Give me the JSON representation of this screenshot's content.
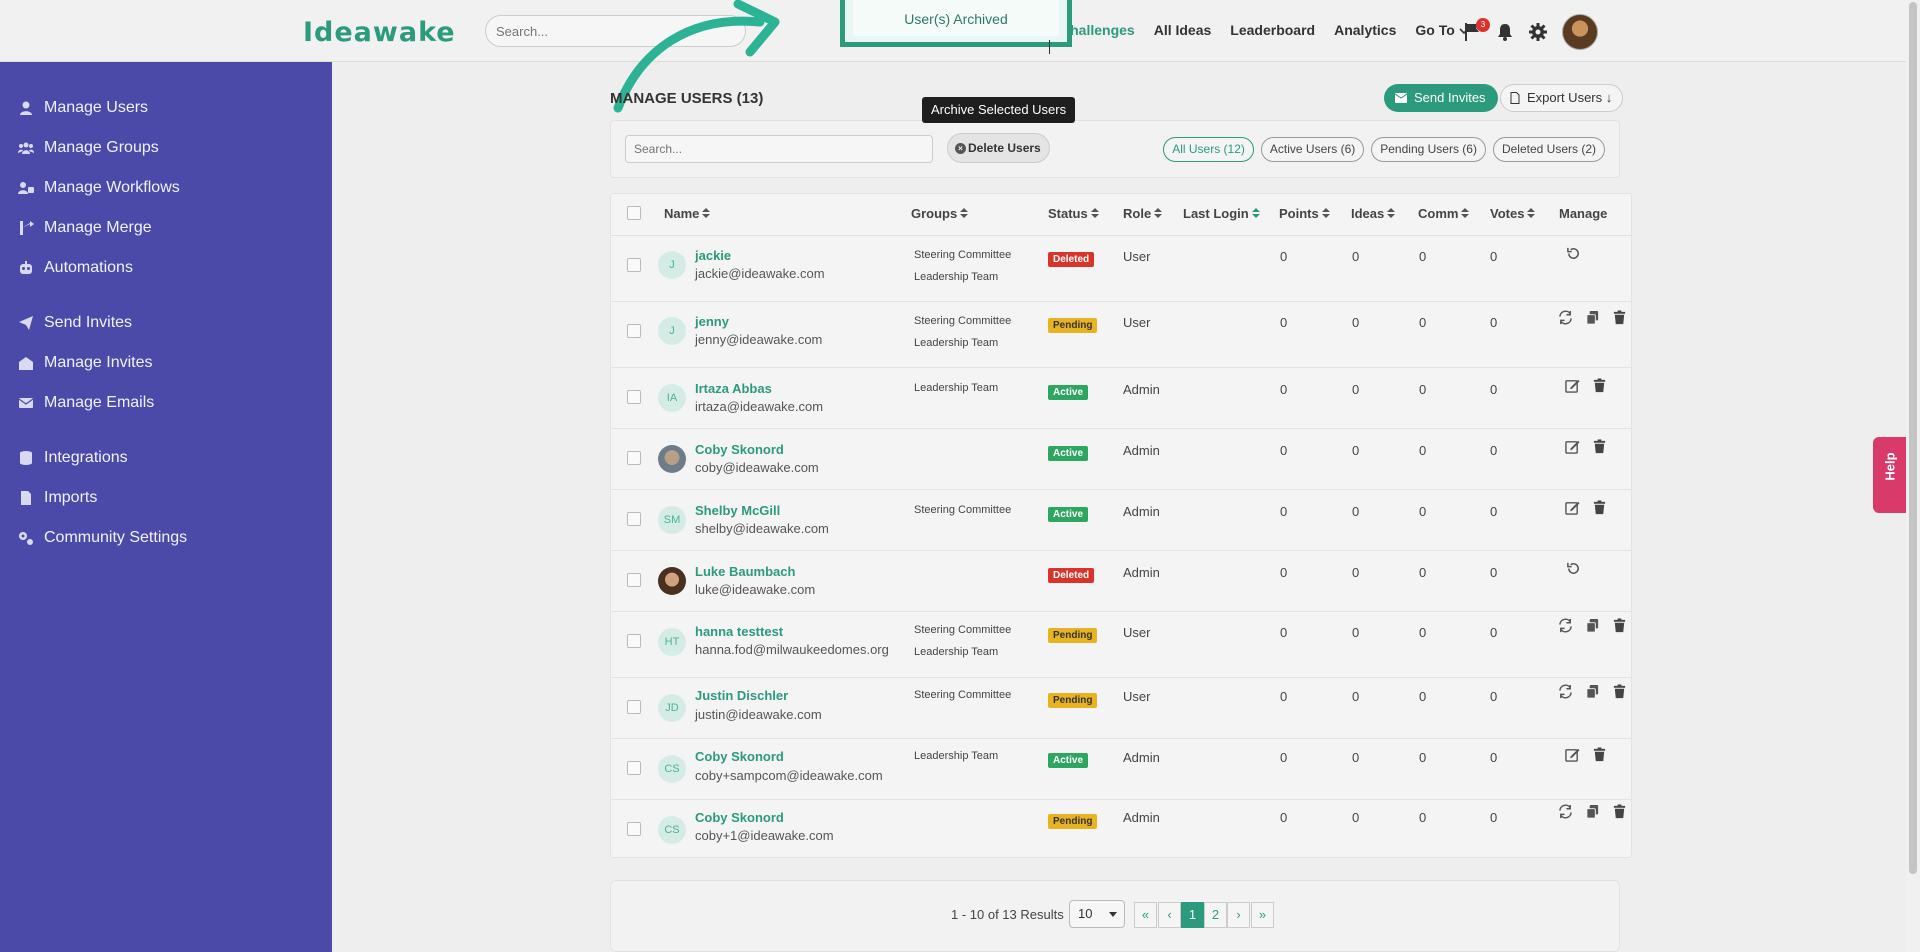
{
  "header": {
    "logo": "Ideawake",
    "search_placeholder": "Search...",
    "nav": [
      "Challenges",
      "All Ideas",
      "Leaderboard",
      "Analytics",
      "Go To"
    ],
    "notification_count": "3"
  },
  "toast": {
    "message": "User(s) Archived"
  },
  "sidebar": {
    "items": [
      {
        "label": "Manage Users",
        "icon": "user-icon"
      },
      {
        "label": "Manage Groups",
        "icon": "users-group-icon"
      },
      {
        "label": "Manage Workflows",
        "icon": "workflow-icon"
      },
      {
        "label": "Manage Merge",
        "icon": "merge-icon"
      },
      {
        "label": "Automations",
        "icon": "robot-icon"
      },
      {
        "label": "Send Invites",
        "icon": "paper-plane-icon"
      },
      {
        "label": "Manage Invites",
        "icon": "envelope-open-icon"
      },
      {
        "label": "Manage Emails",
        "icon": "envelope-icon"
      },
      {
        "label": "Integrations",
        "icon": "database-icon"
      },
      {
        "label": "Imports",
        "icon": "file-icon"
      },
      {
        "label": "Community Settings",
        "icon": "cogs-icon"
      }
    ]
  },
  "main": {
    "title": "MANAGE USERS (13)",
    "send_invites": "Send Invites",
    "export_users": "Export Users",
    "tooltip": "Archive Selected Users",
    "search_placeholder": "Search...",
    "delete_users": "Delete Users",
    "filters": [
      "All Users (12)",
      "Active Users (6)",
      "Pending Users (6)",
      "Deleted Users (2)"
    ],
    "columns": [
      "Name",
      "Groups",
      "Status",
      "Role",
      "Last Login",
      "Points",
      "Ideas",
      "Comm",
      "Votes",
      "Manage"
    ],
    "users": [
      {
        "initials": "J",
        "name": "jackie",
        "email": "jackie@ideawake.com",
        "groups": [
          "Steering Committee",
          "Leadership Team"
        ],
        "status": "Deleted",
        "role": "User",
        "points": "0",
        "ideas": "0",
        "comm": "0",
        "votes": "0"
      },
      {
        "initials": "J",
        "name": "jenny",
        "email": "jenny@ideawake.com",
        "groups": [
          "Steering Committee",
          "Leadership Team"
        ],
        "status": "Pending",
        "role": "User",
        "points": "0",
        "ideas": "0",
        "comm": "0",
        "votes": "0"
      },
      {
        "initials": "IA",
        "name": "Irtaza Abbas",
        "email": "irtaza@ideawake.com",
        "groups": [
          "Leadership Team"
        ],
        "status": "Active",
        "role": "Admin",
        "points": "0",
        "ideas": "0",
        "comm": "0",
        "votes": "0"
      },
      {
        "initials": "",
        "name": "Coby Skonord",
        "email": "coby@ideawake.com",
        "groups": [],
        "status": "Active",
        "role": "Admin",
        "points": "0",
        "ideas": "0",
        "comm": "0",
        "votes": "0"
      },
      {
        "initials": "SM",
        "name": "Shelby McGill",
        "email": "shelby@ideawake.com",
        "groups": [
          "Steering Committee"
        ],
        "status": "Active",
        "role": "Admin",
        "points": "0",
        "ideas": "0",
        "comm": "0",
        "votes": "0"
      },
      {
        "initials": "",
        "name": "Luke Baumbach",
        "email": "luke@ideawake.com",
        "groups": [],
        "status": "Deleted",
        "role": "Admin",
        "points": "0",
        "ideas": "0",
        "comm": "0",
        "votes": "0"
      },
      {
        "initials": "HT",
        "name": "hanna testtest",
        "email": "hanna.fod@milwaukeedomes.org",
        "groups": [
          "Steering Committee",
          "Leadership Team"
        ],
        "status": "Pending",
        "role": "User",
        "points": "0",
        "ideas": "0",
        "comm": "0",
        "votes": "0"
      },
      {
        "initials": "JD",
        "name": "Justin Dischler",
        "email": "justin@ideawake.com",
        "groups": [
          "Steering Committee"
        ],
        "status": "Pending",
        "role": "User",
        "points": "0",
        "ideas": "0",
        "comm": "0",
        "votes": "0"
      },
      {
        "initials": "CS",
        "name": "Coby Skonord",
        "email": "coby+sampcom@ideawake.com",
        "groups": [
          "Leadership Team"
        ],
        "status": "Active",
        "role": "Admin",
        "points": "0",
        "ideas": "0",
        "comm": "0",
        "votes": "0"
      },
      {
        "initials": "CS",
        "name": "Coby Skonord",
        "email": "coby+1@ideawake.com",
        "groups": [],
        "status": "Pending",
        "role": "Admin",
        "points": "0",
        "ideas": "0",
        "comm": "0",
        "votes": "0"
      }
    ]
  },
  "pagination": {
    "summary": "1 - 10 of 13 Results",
    "per_page": "10",
    "pages": [
      "1",
      "2"
    ],
    "current": "1"
  },
  "help": {
    "label": "Help"
  },
  "colors": {
    "brand": "#2c9a7d",
    "sidebar": "#4b4aa8",
    "deleted": "#d9342b",
    "pending": "#e8b321",
    "active": "#2da760"
  }
}
